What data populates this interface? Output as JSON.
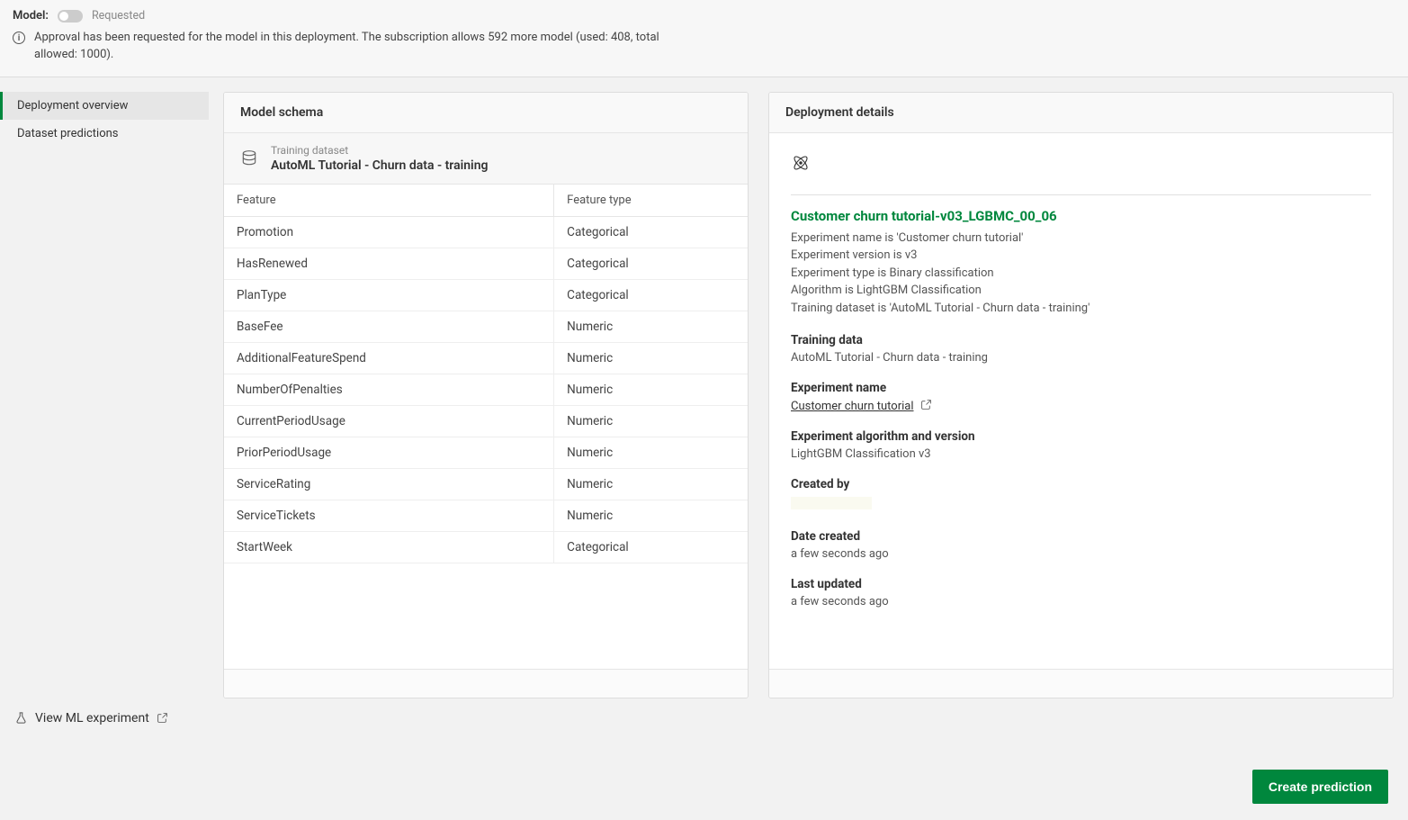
{
  "topbar": {
    "model_label": "Model:",
    "status_text": "Requested",
    "approval_msg": "Approval has been requested for the model in this deployment. The subscription allows 592 more model (used: 408, total allowed: 1000)."
  },
  "sidebar": {
    "items": [
      {
        "label": "Deployment overview",
        "active": true
      },
      {
        "label": "Dataset predictions",
        "active": false
      }
    ],
    "view_ml": "View ML experiment"
  },
  "schema": {
    "panel_title": "Model schema",
    "dataset_label": "Training dataset",
    "dataset_name": "AutoML Tutorial - Churn data - training",
    "col_feature": "Feature",
    "col_type": "Feature type",
    "rows": [
      {
        "feature": "Promotion",
        "type": "Categorical"
      },
      {
        "feature": "HasRenewed",
        "type": "Categorical"
      },
      {
        "feature": "PlanType",
        "type": "Categorical"
      },
      {
        "feature": "BaseFee",
        "type": "Numeric"
      },
      {
        "feature": "AdditionalFeatureSpend",
        "type": "Numeric"
      },
      {
        "feature": "NumberOfPenalties",
        "type": "Numeric"
      },
      {
        "feature": "CurrentPeriodUsage",
        "type": "Numeric"
      },
      {
        "feature": "PriorPeriodUsage",
        "type": "Numeric"
      },
      {
        "feature": "ServiceRating",
        "type": "Numeric"
      },
      {
        "feature": "ServiceTickets",
        "type": "Numeric"
      },
      {
        "feature": "StartWeek",
        "type": "Categorical"
      }
    ]
  },
  "details": {
    "panel_title": "Deployment details",
    "model_title": "Customer churn tutorial-v03_LGBMC_00_06",
    "meta_lines": [
      "Experiment name is 'Customer churn tutorial'",
      "Experiment version is v3",
      "Experiment type is Binary classification",
      "Algorithm is LightGBM Classification",
      "Training dataset is 'AutoML Tutorial - Churn data - training'"
    ],
    "training_data_h": "Training data",
    "training_data_v": "AutoML Tutorial - Churn data - training",
    "exp_name_h": "Experiment name",
    "exp_name_v": "Customer churn tutorial",
    "algo_h": "Experiment algorithm and version",
    "algo_v": "LightGBM Classification v3",
    "created_by_h": "Created by",
    "date_created_h": "Date created",
    "date_created_v": "a few seconds ago",
    "last_updated_h": "Last updated",
    "last_updated_v": "a few seconds ago"
  },
  "create_btn": "Create prediction"
}
